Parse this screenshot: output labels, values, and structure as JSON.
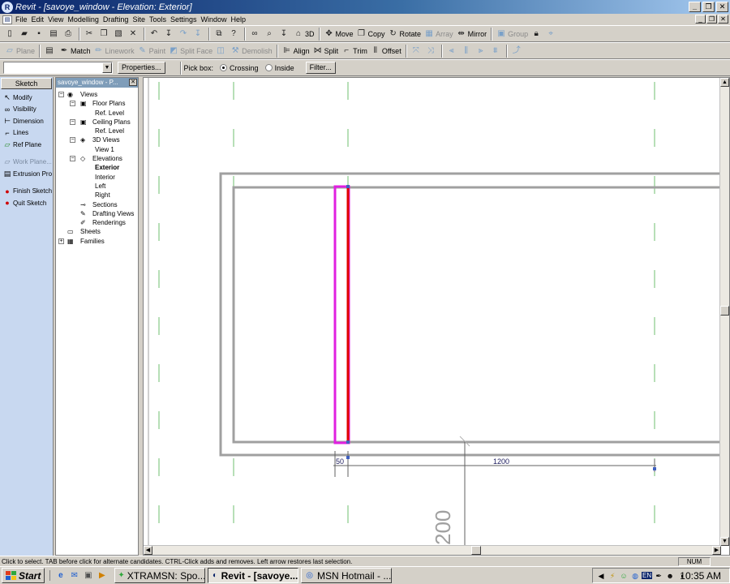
{
  "window": {
    "title": "Revit - [savoye_window - Elevation: Exterior]",
    "app_icon": "revit-logo-icon",
    "controls": {
      "minimize": "_",
      "maximize": "❐",
      "close": "✕"
    }
  },
  "menu": {
    "items": [
      "File",
      "Edit",
      "View",
      "Modelling",
      "Drafting",
      "Site",
      "Tools",
      "Settings",
      "Window",
      "Help"
    ],
    "mdi_controls": {
      "minimize": "_",
      "restore": "❐",
      "close": "✕"
    }
  },
  "toolbar1": {
    "move": "Move",
    "copy": "Copy",
    "rotate": "Rotate",
    "array": "Array",
    "mirror": "Mirror",
    "group": "Group",
    "view_3d": "3D"
  },
  "toolbar2": {
    "plane": "Plane",
    "match": "Match",
    "linework": "Linework",
    "paint": "Paint",
    "split_face": "Split Face",
    "demolish": "Demolish",
    "align": "Align",
    "split": "Split",
    "trim": "Trim",
    "offset": "Offset"
  },
  "options_bar": {
    "type_selector_value": "",
    "properties_button": "Properties...",
    "pick_box_label": "Pick box:",
    "crossing": "Crossing",
    "inside": "Inside",
    "selected_mode": "crossing",
    "filter_button": "Filter..."
  },
  "sketch_panel": {
    "title": "Sketch",
    "items": [
      {
        "label": "Modify",
        "icon": "arrow-cursor-icon",
        "glyph": "↖",
        "enabled": true
      },
      {
        "label": "Visibility",
        "icon": "eyeglasses-icon",
        "glyph": "∞",
        "enabled": true
      },
      {
        "label": "Dimension",
        "icon": "dimension-icon",
        "glyph": "⊢",
        "enabled": true
      },
      {
        "label": "Lines",
        "icon": "lines-icon",
        "glyph": "⌐",
        "enabled": true
      },
      {
        "label": "Ref Plane",
        "icon": "ref-plane-icon",
        "glyph": "▱",
        "enabled": true
      },
      {
        "label": "Work Plane...",
        "icon": "work-plane-icon",
        "glyph": "▱",
        "enabled": false
      },
      {
        "label": "Extrusion Pro",
        "icon": "extrusion-properties-icon",
        "glyph": "▤",
        "enabled": true
      },
      {
        "label": "Finish Sketch",
        "icon": "finish-sketch-icon",
        "glyph": "●",
        "enabled": true
      },
      {
        "label": "Quit Sketch",
        "icon": "quit-sketch-icon",
        "glyph": "●",
        "enabled": true
      }
    ]
  },
  "project_browser": {
    "title": "savoye_window - P...",
    "nodes": [
      {
        "label": "Views",
        "level": 0,
        "expander": "−",
        "icon": "eye-icon",
        "glyph": "◉"
      },
      {
        "label": "Floor Plans",
        "level": 1,
        "expander": "−",
        "icon": "floor-plan-icon",
        "glyph": "▣"
      },
      {
        "label": "Ref. Level",
        "level": 2
      },
      {
        "label": "Ceiling Plans",
        "level": 1,
        "expander": "−",
        "icon": "ceiling-plan-icon",
        "glyph": "▣"
      },
      {
        "label": "Ref. Level",
        "level": 2
      },
      {
        "label": "3D Views",
        "level": 1,
        "expander": "−",
        "icon": "3d-view-icon",
        "glyph": "◈"
      },
      {
        "label": "View 1",
        "level": 2
      },
      {
        "label": "Elevations",
        "level": 1,
        "expander": "−",
        "icon": "elevation-icon",
        "glyph": "◇"
      },
      {
        "label": "Exterior",
        "level": 2,
        "bold": true
      },
      {
        "label": "Interior",
        "level": 2
      },
      {
        "label": "Left",
        "level": 2
      },
      {
        "label": "Right",
        "level": 2
      },
      {
        "label": "Sections",
        "level": 1,
        "icon": "section-icon",
        "glyph": "⊸"
      },
      {
        "label": "Drafting Views",
        "level": 1,
        "icon": "drafting-view-icon",
        "glyph": "✎"
      },
      {
        "label": "Renderings",
        "level": 1,
        "icon": "rendering-icon",
        "glyph": "✐"
      },
      {
        "label": "Sheets",
        "level": 0,
        "icon": "sheet-icon",
        "glyph": "▭"
      },
      {
        "label": "Families",
        "level": 0,
        "expander": "+",
        "icon": "families-icon",
        "glyph": "▦"
      }
    ]
  },
  "canvas": {
    "dimension_left": "50",
    "dimension_right": "1200",
    "dimension_vertical": "200",
    "colors": {
      "outline": "#a0a0a0",
      "reference_plane": "#6fbf6f",
      "sketch_magenta": "#e020e0",
      "sketch_red": "#e00000",
      "dimension": "#0000a0",
      "dimension_text": "#202060"
    }
  },
  "status": {
    "text": "Click to select. TAB before click for alternate candidates. CTRL-Click adds and removes. Left arrow restores last selection.",
    "num": "NUM"
  },
  "taskbar": {
    "start": "Start",
    "quicklaunch": [
      {
        "icon": "internet-explorer-icon",
        "glyph": "e"
      },
      {
        "icon": "outlook-express-icon",
        "glyph": "✉"
      },
      {
        "icon": "desktop-icon",
        "glyph": "▣"
      },
      {
        "icon": "media-player-icon",
        "glyph": "▶"
      }
    ],
    "tasks": [
      {
        "label": "XTRAMSN: Spo...",
        "icon": "msn-messenger-icon",
        "glyph": "✦",
        "active": false
      },
      {
        "label": "Revit - [savoye...",
        "icon": "revit-task-icon",
        "glyph": "◐",
        "active": true
      },
      {
        "label": "MSN Hotmail - ...",
        "icon": "browser-task-icon",
        "glyph": "◎",
        "active": false
      }
    ],
    "tray_icons": [
      {
        "icon": "volume-icon",
        "glyph": "◀"
      },
      {
        "icon": "network-icon",
        "glyph": "⚡"
      },
      {
        "icon": "messenger-tray-icon",
        "glyph": "☺"
      },
      {
        "icon": "globe-icon",
        "glyph": "◍"
      }
    ],
    "language": "EN",
    "tray_icons_right": [
      {
        "icon": "ink-icon",
        "glyph": "✒"
      },
      {
        "icon": "users-icon",
        "glyph": "☻"
      },
      {
        "icon": "display-icon",
        "glyph": "◑"
      }
    ],
    "clock": "10:35 AM"
  }
}
